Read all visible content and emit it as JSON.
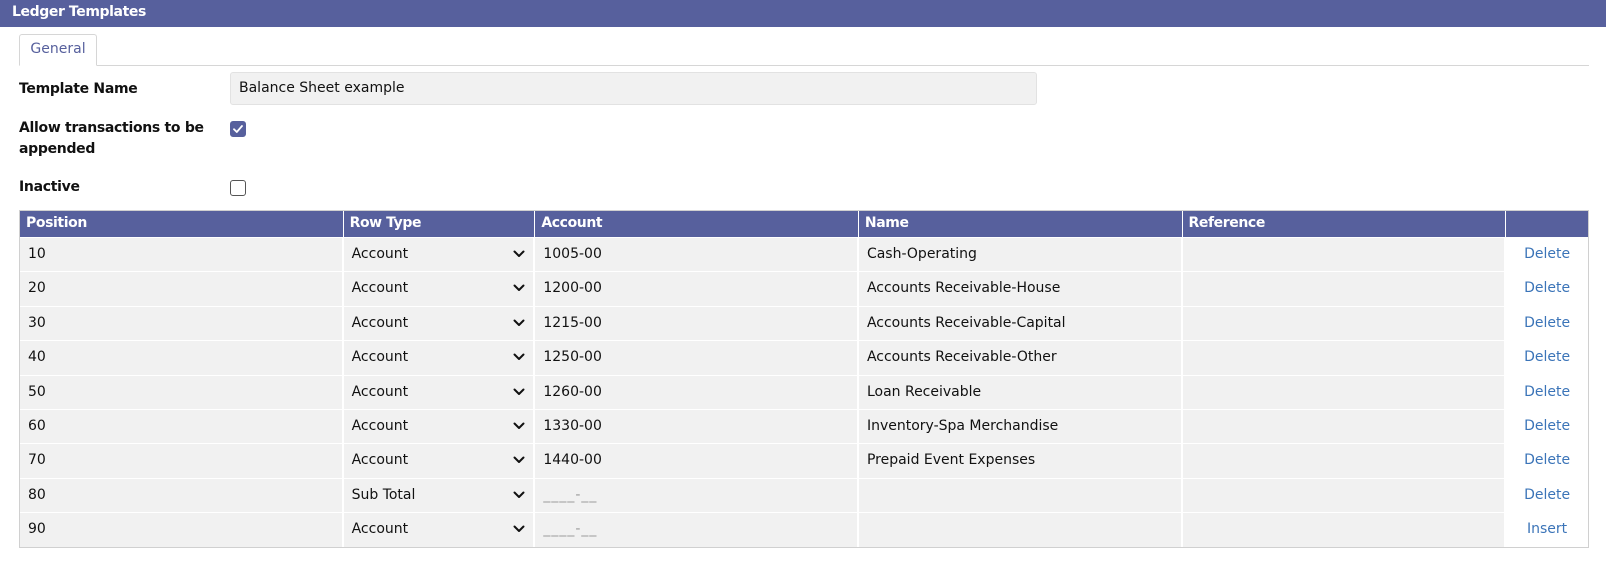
{
  "window": {
    "title": "Ledger Templates"
  },
  "tabs": [
    {
      "label": "General",
      "active": true
    }
  ],
  "form": {
    "template_name_label": "Template Name",
    "template_name_value": "Balance Sheet example",
    "allow_append_label_line1": "Allow transactions to be",
    "allow_append_label_line2": "appended",
    "allow_append_checked": true,
    "inactive_label": "Inactive",
    "inactive_checked": false
  },
  "grid": {
    "columns": [
      "Position",
      "Row Type",
      "Account",
      "Name",
      "Reference",
      ""
    ],
    "rows": [
      {
        "position": "10",
        "row_type": "Account",
        "account": "1005-00",
        "name": "Cash-Operating",
        "reference": "",
        "action": "Delete"
      },
      {
        "position": "20",
        "row_type": "Account",
        "account": "1200-00",
        "name": "Accounts Receivable-House",
        "reference": "",
        "action": "Delete"
      },
      {
        "position": "30",
        "row_type": "Account",
        "account": "1215-00",
        "name": "Accounts Receivable-Capital",
        "reference": "",
        "action": "Delete"
      },
      {
        "position": "40",
        "row_type": "Account",
        "account": "1250-00",
        "name": "Accounts Receivable-Other",
        "reference": "",
        "action": "Delete"
      },
      {
        "position": "50",
        "row_type": "Account",
        "account": "1260-00",
        "name": "Loan Receivable",
        "reference": "",
        "action": "Delete"
      },
      {
        "position": "60",
        "row_type": "Account",
        "account": "1330-00",
        "name": "Inventory-Spa Merchandise",
        "reference": "",
        "action": "Delete"
      },
      {
        "position": "70",
        "row_type": "Account",
        "account": "1440-00",
        "name": "Prepaid Event Expenses",
        "reference": "",
        "action": "Delete"
      },
      {
        "position": "80",
        "row_type": "Sub Total",
        "account": "____-__",
        "name": "",
        "reference": "",
        "action": "Delete"
      },
      {
        "position": "90",
        "row_type": "Account",
        "account": "____-__",
        "name": "",
        "reference": "",
        "action": "Insert"
      }
    ]
  },
  "colors": {
    "header": "#57609d",
    "link": "#3b74b8",
    "cell_bg": "#f1f1f1"
  },
  "icons": {
    "dropdown": "chevron-down-icon",
    "check": "checkmark-icon"
  }
}
